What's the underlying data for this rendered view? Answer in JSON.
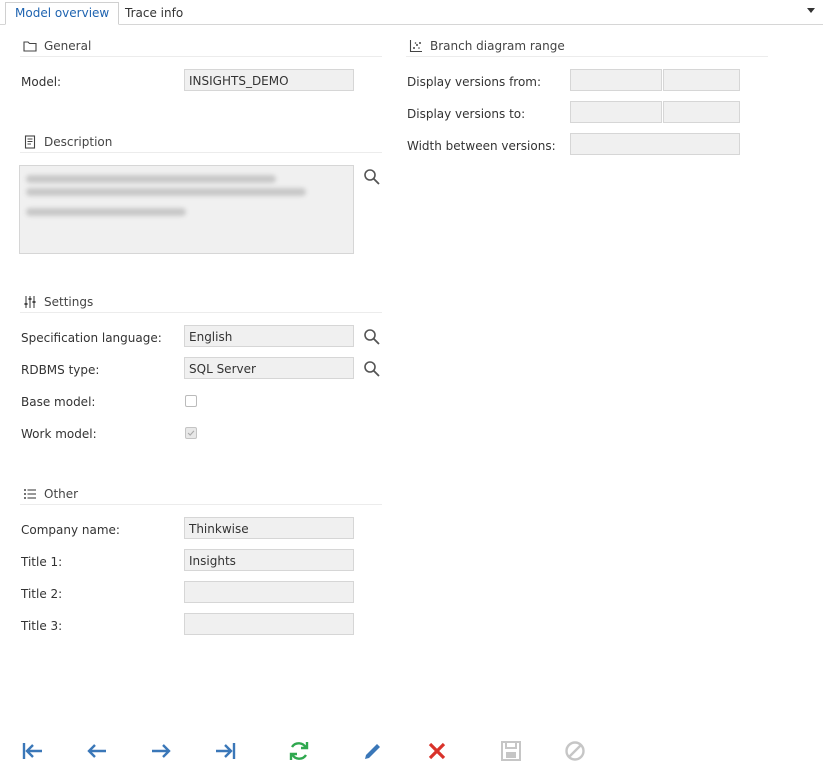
{
  "tabs": [
    {
      "label": "Model overview",
      "active": true
    },
    {
      "label": "Trace info",
      "active": false
    }
  ],
  "general": {
    "title": "General",
    "model_label": "Model:",
    "model_value": "INSIGHTS_DEMO"
  },
  "description": {
    "title": "Description"
  },
  "settings": {
    "title": "Settings",
    "spec_language_label": "Specification language:",
    "spec_language_value": "English",
    "rdbms_label": "RDBMS type:",
    "rdbms_value": "SQL Server",
    "base_model_label": "Base model:",
    "base_model_checked": false,
    "work_model_label": "Work model:",
    "work_model_checked": true
  },
  "other": {
    "title": "Other",
    "company_label": "Company name:",
    "company_value": "Thinkwise",
    "title1_label": "Title 1:",
    "title1_value": "Insights",
    "title2_label": "Title 2:",
    "title2_value": "",
    "title3_label": "Title 3:",
    "title3_value": ""
  },
  "branch": {
    "title": "Branch diagram range",
    "from_label": "Display versions from:",
    "to_label": "Display versions to:",
    "width_label": "Width between versions:"
  },
  "toolbar_icons": [
    "first-record-icon",
    "previous-record-icon",
    "next-record-icon",
    "last-record-icon",
    "refresh-icon",
    "edit-icon",
    "delete-icon",
    "save-icon",
    "cancel-icon"
  ],
  "colors": {
    "accent": "#1e63b0",
    "nav_arrow": "#3a77b8",
    "refresh": "#2fa84f",
    "delete": "#d9322a",
    "disabled": "#c6c6c6"
  }
}
